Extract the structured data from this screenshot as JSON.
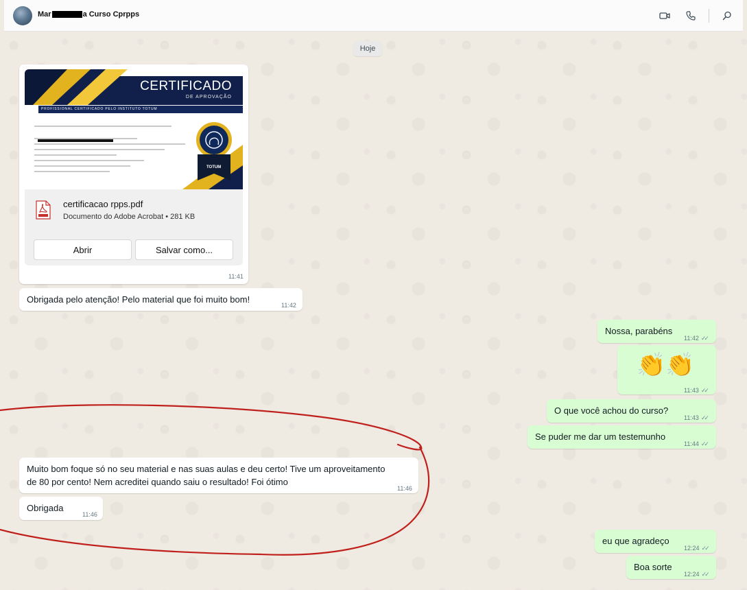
{
  "header": {
    "contact_name_start": "Mar",
    "contact_name_end": "a Curso Cprpps",
    "icons": [
      "video-call-icon",
      "voice-call-icon",
      "search-icon"
    ]
  },
  "date_separator": "Hoje",
  "file_message": {
    "certificate": {
      "title": "CERTIFICADO",
      "subtitle": "DE APROVAÇÃO",
      "band_text": "PROFISSIONAL CERTIFICADO PELO INSTITUTO TOTUM",
      "seal_text": "TOTUM"
    },
    "file_name": "certificacao rpps.pdf",
    "file_meta": "Documento do Adobe Acrobat • 281 KB",
    "open_label": "Abrir",
    "save_label": "Salvar como...",
    "time": "11:41"
  },
  "messages": [
    {
      "dir": "in",
      "text": "Obrigada pelo atenção! Pelo material que foi muito bom!",
      "time": "11:42"
    },
    {
      "dir": "out",
      "text": "Nossa, parabéns",
      "time": "11:42"
    },
    {
      "dir": "out",
      "text": "👏👏",
      "time": "11:43"
    },
    {
      "dir": "out",
      "text": "O que você achou do curso?",
      "time": "11:43"
    },
    {
      "dir": "out",
      "text": "Se puder me dar um testemunho",
      "time": "11:44"
    },
    {
      "dir": "in",
      "text_line1": "Muito bom foque só no seu material e nas suas aulas e deu certo! Tive um aproveitamento",
      "text_line2": "de 80 por cento! Nem acreditei quando saiu o resultado! Foi ótimo",
      "time": "11:46"
    },
    {
      "dir": "in",
      "text": "Obrigada",
      "time": "11:46"
    },
    {
      "dir": "out",
      "text": "eu que agradeço",
      "time": "12:24"
    },
    {
      "dir": "out",
      "text": "Boa sorte",
      "time": "12:24"
    }
  ],
  "colors": {
    "outgoing_bubble": "#d9fdd3",
    "incoming_bubble": "#ffffff",
    "background": "#efeae2",
    "annotation_circle": "#c0201c"
  }
}
